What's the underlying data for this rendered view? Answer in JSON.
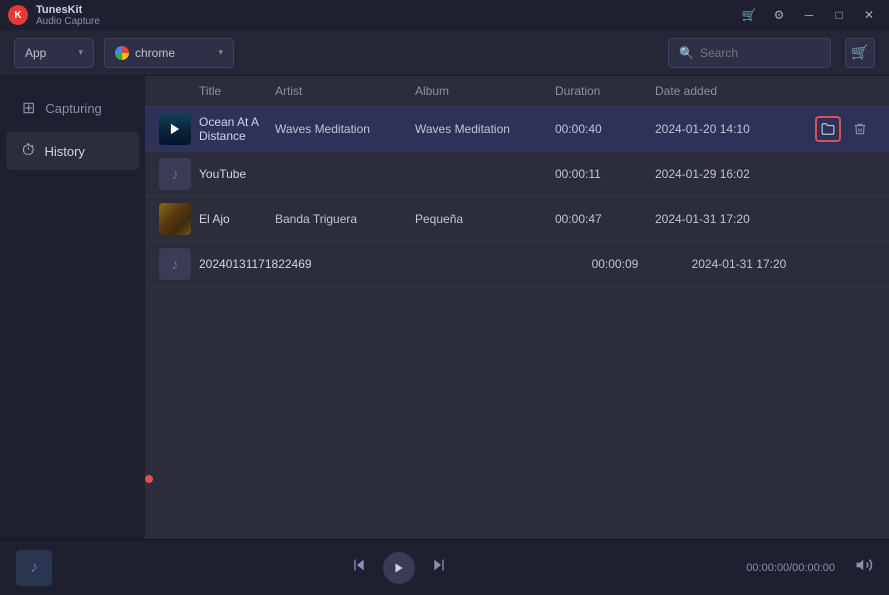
{
  "app": {
    "name": "TunesKit",
    "sub": "Audio Capture",
    "icon": "K"
  },
  "titlebar": {
    "buttons": {
      "cart": "🛒",
      "minimize": "─",
      "maximize": "□",
      "close": "✕"
    },
    "icons": {
      "cart_icon": "🛒",
      "settings_icon": "⚙",
      "dash_icon": "─"
    }
  },
  "toolbar": {
    "source_label": "App",
    "browser_label": "chrome",
    "search_placeholder": "Search"
  },
  "sidebar": {
    "items": [
      {
        "id": "capturing",
        "label": "Capturing",
        "icon": "⊞"
      },
      {
        "id": "history",
        "label": "History",
        "icon": "⏱"
      }
    ]
  },
  "table": {
    "headers": {
      "title": "Title",
      "artist": "Artist",
      "album": "Album",
      "duration": "Duration",
      "date_added": "Date added"
    },
    "rows": [
      {
        "id": 1,
        "title": "Ocean At A Distance",
        "artist": "Waves Meditation",
        "album": "Waves Meditation",
        "duration": "00:00:40",
        "date_added": "2024-01-20 14:10",
        "thumb_type": "ocean",
        "selected": true
      },
      {
        "id": 2,
        "title": "YouTube",
        "artist": "",
        "album": "",
        "duration": "00:00:11",
        "date_added": "2024-01-29 16:02",
        "thumb_type": "music",
        "selected": false
      },
      {
        "id": 3,
        "title": "El Ajo",
        "artist": "Banda Triguera",
        "album": "Pequeña",
        "duration": "00:00:47",
        "date_added": "2024-01-31 17:20",
        "thumb_type": "elajo",
        "selected": false
      },
      {
        "id": 4,
        "title": "20240131171822469",
        "artist": "",
        "album": "",
        "duration": "00:00:09",
        "date_added": "2024-01-31 17:20",
        "thumb_type": "music",
        "selected": false
      }
    ]
  },
  "player": {
    "time_display": "00:00:00/00:00:00",
    "prev_btn": "⏮",
    "play_btn": "▶",
    "next_btn": "⏭",
    "volume_btn": "🔊"
  },
  "colors": {
    "accent_red": "#e05050",
    "sidebar_bg": "#1e2030",
    "content_bg": "#2b2d3a",
    "selected_row": "#2e3258",
    "toolbar_bg": "#252737"
  }
}
